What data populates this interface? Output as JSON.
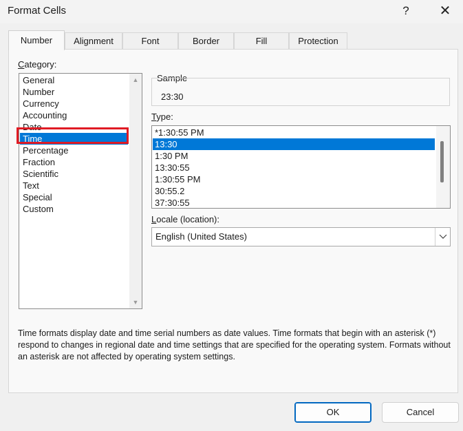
{
  "window": {
    "title": "Format Cells",
    "help": "?",
    "close": "✕"
  },
  "tabs": [
    "Number",
    "Alignment",
    "Font",
    "Border",
    "Fill",
    "Protection"
  ],
  "category": {
    "label_u": "C",
    "label_rest": "ategory:",
    "items": [
      "General",
      "Number",
      "Currency",
      "Accounting",
      "Date",
      "Time",
      "Percentage",
      "Fraction",
      "Scientific",
      "Text",
      "Special",
      "Custom"
    ],
    "selected": "Time"
  },
  "sample": {
    "label": "Sample",
    "value": "23:30"
  },
  "type": {
    "label_u": "T",
    "label_rest": "ype:",
    "items": [
      "*1:30:55 PM",
      "13:30",
      "1:30 PM",
      "13:30:55",
      "1:30:55 PM",
      "30:55.2",
      "37:30:55"
    ],
    "selected": "13:30"
  },
  "locale": {
    "label_u": "L",
    "label_rest": "ocale (location):",
    "value": "English (United States)"
  },
  "description": "Time formats display date and time serial numbers as date values.  Time formats that begin with an asterisk (*) respond to changes in regional date and time settings that are specified for the operating system. Formats without an asterisk are not affected by operating system settings.",
  "buttons": {
    "ok": "OK",
    "cancel": "Cancel"
  },
  "colors": {
    "selection": "#0078d7",
    "highlight_box": "#e01b24"
  }
}
